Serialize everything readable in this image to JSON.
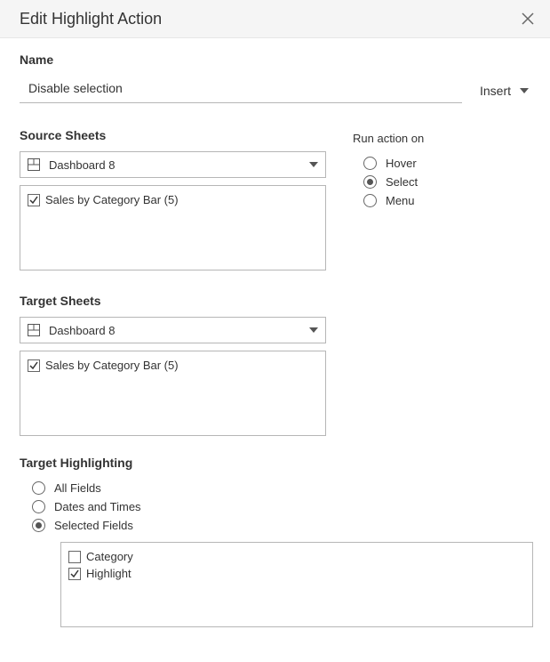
{
  "dialog": {
    "title": "Edit Highlight Action"
  },
  "name": {
    "label": "Name",
    "value": "Disable selection",
    "insert_label": "Insert"
  },
  "source": {
    "label": "Source Sheets",
    "dropdown_value": "Dashboard 8",
    "sheets": [
      {
        "label": "Sales by Category Bar (5)",
        "checked": true
      }
    ]
  },
  "run_action": {
    "label": "Run action on",
    "options": {
      "hover": "Hover",
      "select": "Select",
      "menu": "Menu"
    },
    "selected": "select"
  },
  "target": {
    "label": "Target Sheets",
    "dropdown_value": "Dashboard 8",
    "sheets": [
      {
        "label": "Sales by Category Bar (5)",
        "checked": true
      }
    ]
  },
  "highlighting": {
    "label": "Target Highlighting",
    "options": {
      "all": "All Fields",
      "dates": "Dates and Times",
      "selected": "Selected Fields"
    },
    "selected": "selected",
    "fields": [
      {
        "label": "Category",
        "checked": false
      },
      {
        "label": "Highlight",
        "checked": true
      }
    ]
  }
}
